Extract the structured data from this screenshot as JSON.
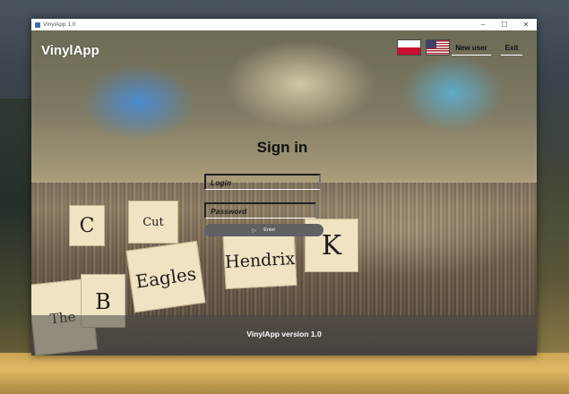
{
  "window": {
    "title": "VinylApp 1.0",
    "controls": [
      "–",
      "☐",
      "✕"
    ]
  },
  "header": {
    "brand": "VinylApp",
    "languages": [
      {
        "code": "pl",
        "icon": "flag-poland-icon"
      },
      {
        "code": "en",
        "icon": "flag-usa-icon"
      }
    ],
    "new_user_label": "New user",
    "exit_label": "Exit"
  },
  "background_cards": [
    "C",
    "Cut",
    "Eagles",
    "Hendrix",
    "K",
    "The Doors",
    "B"
  ],
  "signin": {
    "title": "Sign in",
    "login_placeholder": "Login",
    "password_placeholder": "Password",
    "enter_arrow": "▷",
    "enter_label": "Enter"
  },
  "footer": {
    "version_text": "VinylApp version 1.0"
  }
}
